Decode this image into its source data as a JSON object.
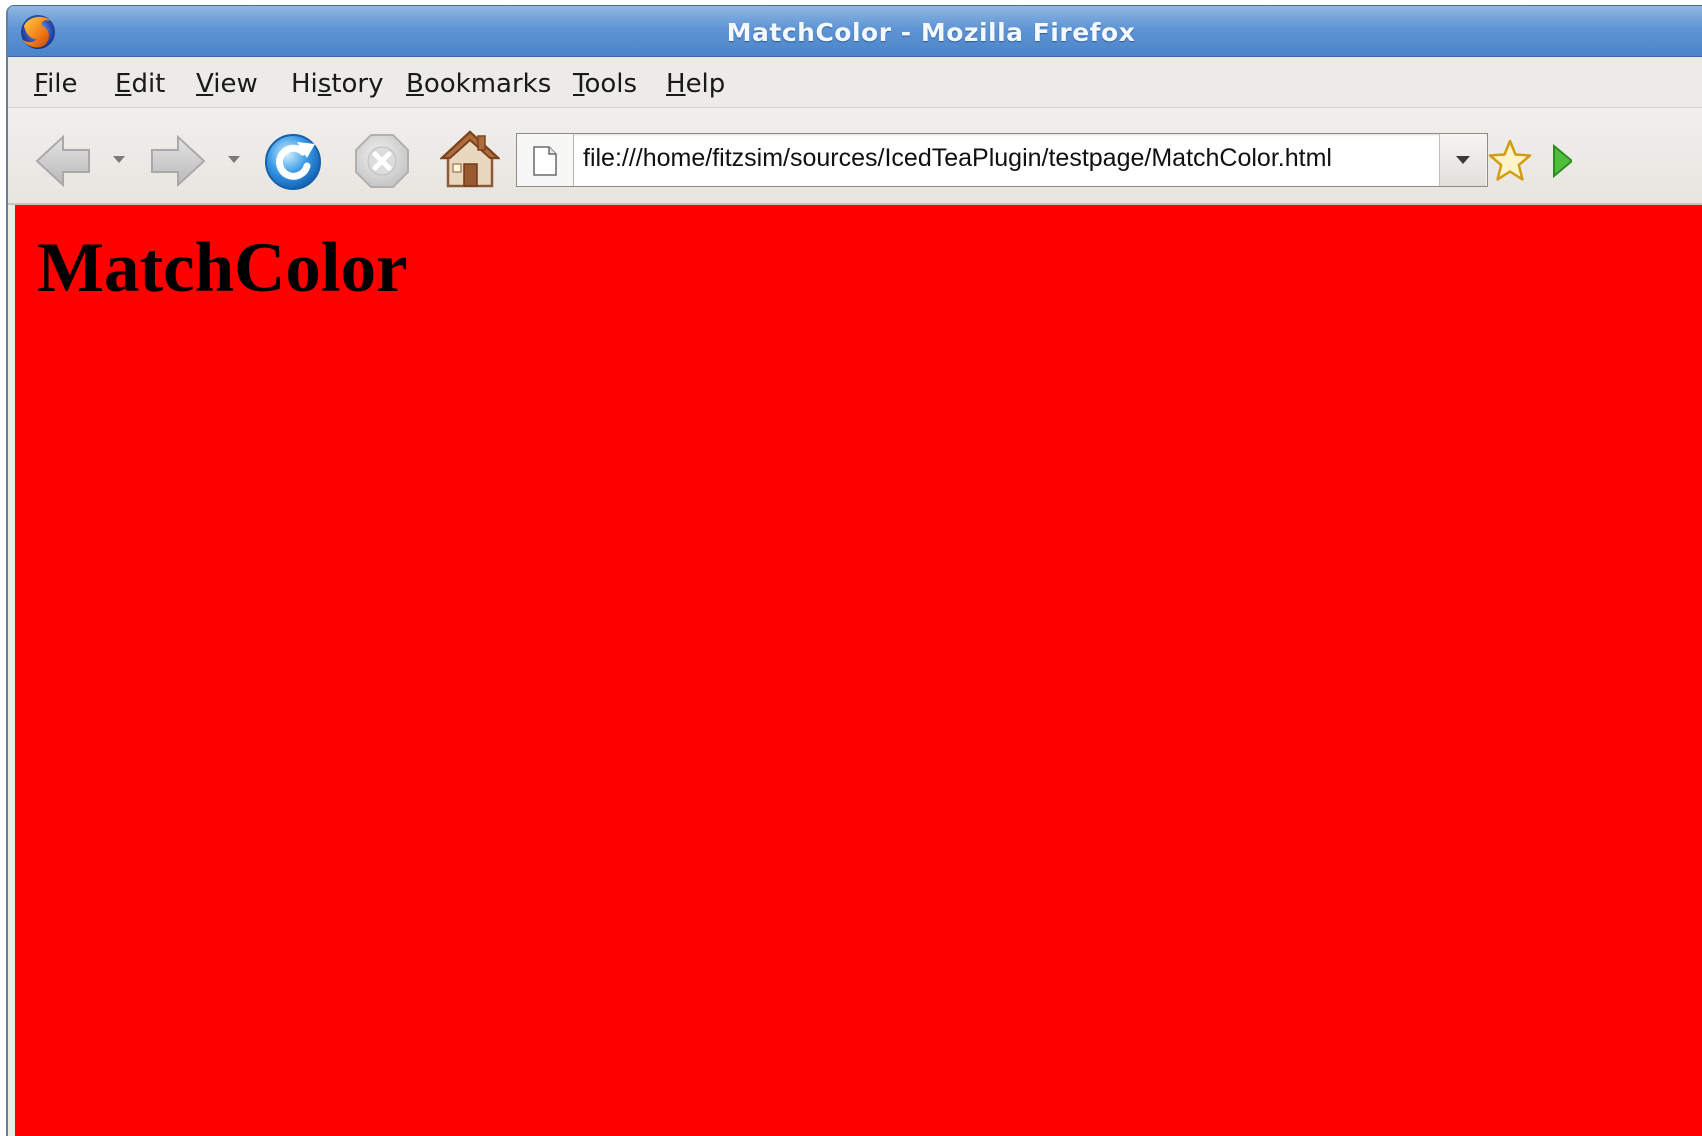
{
  "window": {
    "title": "MatchColor - Mozilla Firefox"
  },
  "menubar": {
    "items": [
      {
        "label": "File",
        "mnemonic": "F"
      },
      {
        "label": "Edit",
        "mnemonic": "E"
      },
      {
        "label": "View",
        "mnemonic": "V"
      },
      {
        "label": "History",
        "mnemonic": "s"
      },
      {
        "label": "Bookmarks",
        "mnemonic": "B"
      },
      {
        "label": "Tools",
        "mnemonic": "T"
      },
      {
        "label": "Help",
        "mnemonic": "H"
      }
    ]
  },
  "navbar": {
    "icons": [
      "back-arrow-icon",
      "forward-arrow-icon",
      "reload-icon",
      "stop-icon",
      "home-icon",
      "bookmark-star-icon",
      "go-arrow-icon"
    ],
    "url": "file:///home/fitzsim/sources/IcedTeaPlugin/testpage/MatchColor.html"
  },
  "page": {
    "heading": "MatchColor",
    "background_color": "#ff0000",
    "heading_color": "#000000"
  },
  "colors": {
    "titlebar": "#5f95d4",
    "chrome": "#edebe8",
    "reload_blue": "#2f8fe0"
  }
}
